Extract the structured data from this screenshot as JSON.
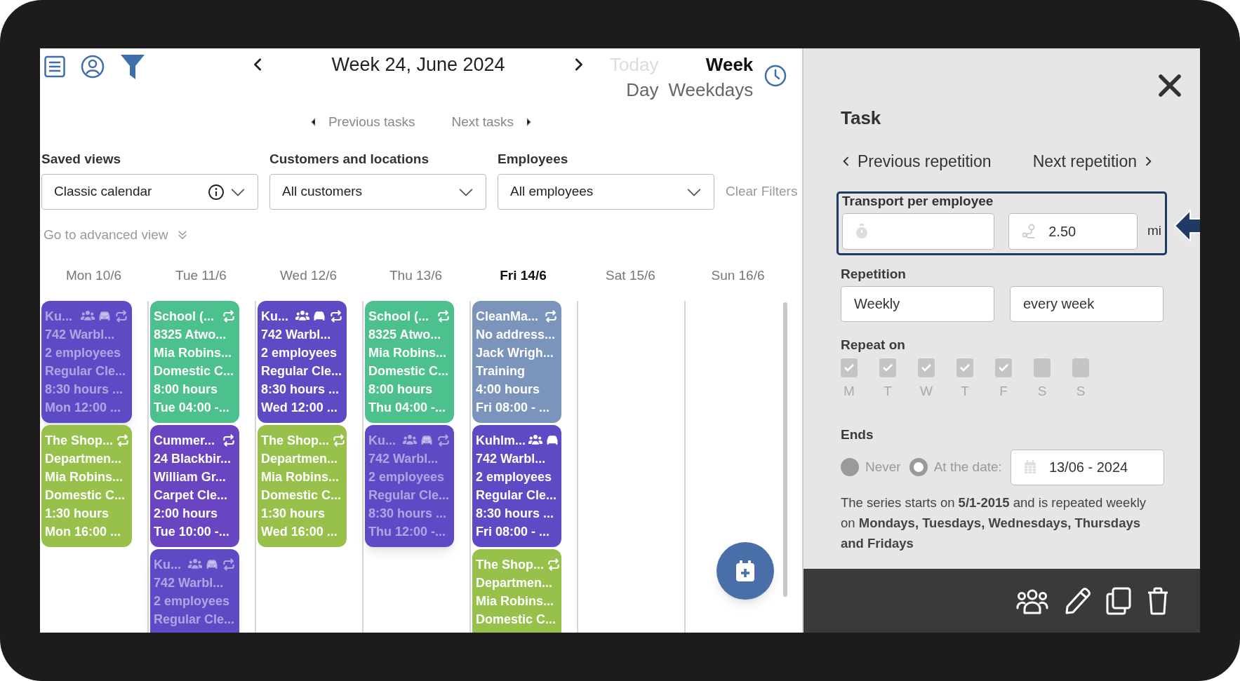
{
  "toolbar": {
    "title": "Week 24, June 2024",
    "views": [
      {
        "label": "Today",
        "selected": false,
        "disabled": true
      },
      {
        "label": "Week",
        "selected": true,
        "disabled": false
      },
      {
        "label": "Day",
        "selected": false,
        "disabled": false
      },
      {
        "label": "Weekdays",
        "selected": false,
        "disabled": false
      }
    ]
  },
  "task_nav": [
    "Previous tasks",
    "Next tasks"
  ],
  "filters": [
    {
      "label": "Saved views",
      "value": "Classic calendar",
      "info": true
    },
    {
      "label": "Customers and locations",
      "value": "All customers",
      "info": false
    },
    {
      "label": "Employees",
      "value": "All employees",
      "info": false
    }
  ],
  "clear_filters": "Clear Filters",
  "advanced_view": "Go to advanced view",
  "days": [
    {
      "label": "Mon 10/6",
      "selected": false,
      "tasks": [
        {
          "title": "Ku...",
          "color": "#5d4bc6",
          "dimmed": true,
          "team": true,
          "car": true,
          "recurring": true,
          "lines": [
            "742 Warbl...",
            "2 employees",
            "Regular Cle...",
            "8:30 hours ...",
            "Mon 12:00 ..."
          ]
        },
        {
          "title": "The Shop...",
          "color": "#97c14b",
          "dimmed": false,
          "team": false,
          "car": false,
          "recurring": true,
          "lines": [
            "Departmen...",
            "Mia Robins...",
            "Domestic C...",
            "1:30 hours",
            "Mon 16:00 ..."
          ]
        }
      ]
    },
    {
      "label": "Tue 11/6",
      "selected": false,
      "tasks": [
        {
          "title": "School (...",
          "color": "#4cc18d",
          "dimmed": false,
          "team": false,
          "car": false,
          "recurring": true,
          "lines": [
            "8325 Atwo...",
            "Mia Robins...",
            "Domestic C...",
            "8:00 hours",
            "Tue 04:00 -..."
          ]
        },
        {
          "title": "Cummer...",
          "color": "#6a45c2",
          "dimmed": false,
          "team": false,
          "car": false,
          "recurring": true,
          "lines": [
            "24 Blackbir...",
            "William Gr...",
            "Carpet Cle...",
            "2:00 hours",
            "Tue 10:00 -..."
          ]
        },
        {
          "title": "Ku...",
          "color": "#5d4bc6",
          "dimmed": true,
          "team": true,
          "car": true,
          "recurring": true,
          "lines": [
            "742 Warbl...",
            "2 employees",
            "Regular Cle..."
          ]
        }
      ]
    },
    {
      "label": "Wed 12/6",
      "selected": false,
      "tasks": [
        {
          "title": "Ku...",
          "color": "#5d4bc6",
          "dimmed": false,
          "team": true,
          "car": true,
          "recurring": true,
          "lines": [
            "742 Warbl...",
            "2 employees",
            "Regular Cle...",
            "8:30 hours ...",
            "Wed 12:00 ..."
          ]
        },
        {
          "title": "The Shop...",
          "color": "#97c14b",
          "dimmed": false,
          "team": false,
          "car": false,
          "recurring": true,
          "lines": [
            "Departmen...",
            "Mia Robins...",
            "Domestic C...",
            "1:30 hours",
            "Wed 16:00 ..."
          ]
        }
      ]
    },
    {
      "label": "Thu 13/6",
      "selected": false,
      "tasks": [
        {
          "title": "School (...",
          "color": "#4cc18d",
          "dimmed": false,
          "team": false,
          "car": false,
          "recurring": true,
          "lines": [
            "8325 Atwo...",
            "Mia Robins...",
            "Domestic C...",
            "8:00 hours",
            "Thu 04:00 -..."
          ]
        },
        {
          "title": "Ku...",
          "color": "#5d4bc6",
          "dimmed": true,
          "team": true,
          "car": true,
          "recurring": true,
          "lines": [
            "742 Warbl...",
            "2 employees",
            "Regular Cle...",
            "8:30 hours ...",
            "Thu 12:00 -..."
          ]
        }
      ]
    },
    {
      "label": "Fri 14/6",
      "selected": true,
      "tasks": [
        {
          "title": "CleanMa...",
          "color": "#7a94bc",
          "dimmed": false,
          "team": false,
          "car": false,
          "recurring": true,
          "lines": [
            "No address...",
            "Jack Wrigh...",
            "Training",
            "4:00 hours",
            "Fri 08:00 - ..."
          ]
        },
        {
          "title": "Kuhlm...",
          "color": "#5d4bc6",
          "dimmed": false,
          "team": true,
          "car": true,
          "recurring": false,
          "lines": [
            "742 Warbl...",
            "2 employees",
            "Regular Cle...",
            "8:30 hours ...",
            "Fri 08:00 - ..."
          ]
        },
        {
          "title": "The Shop...",
          "color": "#97c14b",
          "dimmed": false,
          "team": false,
          "car": false,
          "recurring": true,
          "lines": [
            "Departmen...",
            "Mia Robins...",
            "Domestic C..."
          ]
        }
      ]
    },
    {
      "label": "Sat 15/6",
      "selected": false
    },
    {
      "label": "Sun 16/6",
      "selected": false
    }
  ],
  "panel": {
    "title": "Task",
    "repetition_nav": [
      "Previous repetition",
      "Next repetition"
    ],
    "transport": {
      "label": "Transport per employee",
      "distance": "2.50",
      "unit": "mi",
      "highlighted": true
    },
    "repetition": {
      "label": "Repetition",
      "values": [
        "Weekly",
        "every week"
      ]
    },
    "repeat_on": {
      "label": "Repeat on",
      "days": [
        {
          "letter": "M",
          "checked": true
        },
        {
          "letter": "T",
          "checked": true
        },
        {
          "letter": "W",
          "checked": true
        },
        {
          "letter": "T",
          "checked": true
        },
        {
          "letter": "F",
          "checked": true
        },
        {
          "letter": "S",
          "checked": false
        },
        {
          "letter": "S",
          "checked": false
        }
      ]
    },
    "ends": {
      "label": "Ends",
      "options": [
        {
          "label": "Never",
          "selected": false
        },
        {
          "label": "At the date:",
          "selected": true
        }
      ],
      "date": "13/06 - 2024"
    },
    "summary": "The series starts on **5/1-2015** and is repeated weekly on **Mondays, Tuesdays, Wednesdays, Thursdays and Fridays**"
  }
}
